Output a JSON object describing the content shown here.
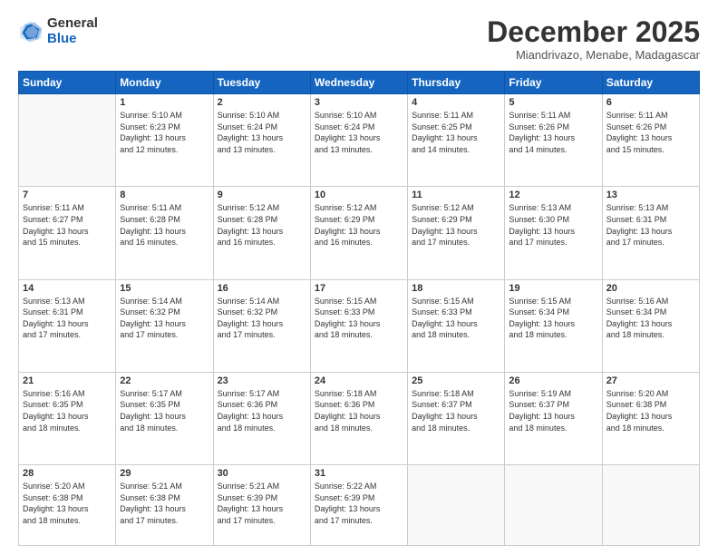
{
  "logo": {
    "general": "General",
    "blue": "Blue"
  },
  "title": "December 2025",
  "subtitle": "Miandrivazo, Menabe, Madagascar",
  "days_header": [
    "Sunday",
    "Monday",
    "Tuesday",
    "Wednesday",
    "Thursday",
    "Friday",
    "Saturday"
  ],
  "weeks": [
    [
      {
        "day": "",
        "info": ""
      },
      {
        "day": "1",
        "info": "Sunrise: 5:10 AM\nSunset: 6:23 PM\nDaylight: 13 hours\nand 12 minutes."
      },
      {
        "day": "2",
        "info": "Sunrise: 5:10 AM\nSunset: 6:24 PM\nDaylight: 13 hours\nand 13 minutes."
      },
      {
        "day": "3",
        "info": "Sunrise: 5:10 AM\nSunset: 6:24 PM\nDaylight: 13 hours\nand 13 minutes."
      },
      {
        "day": "4",
        "info": "Sunrise: 5:11 AM\nSunset: 6:25 PM\nDaylight: 13 hours\nand 14 minutes."
      },
      {
        "day": "5",
        "info": "Sunrise: 5:11 AM\nSunset: 6:26 PM\nDaylight: 13 hours\nand 14 minutes."
      },
      {
        "day": "6",
        "info": "Sunrise: 5:11 AM\nSunset: 6:26 PM\nDaylight: 13 hours\nand 15 minutes."
      }
    ],
    [
      {
        "day": "7",
        "info": "Sunrise: 5:11 AM\nSunset: 6:27 PM\nDaylight: 13 hours\nand 15 minutes."
      },
      {
        "day": "8",
        "info": "Sunrise: 5:11 AM\nSunset: 6:28 PM\nDaylight: 13 hours\nand 16 minutes."
      },
      {
        "day": "9",
        "info": "Sunrise: 5:12 AM\nSunset: 6:28 PM\nDaylight: 13 hours\nand 16 minutes."
      },
      {
        "day": "10",
        "info": "Sunrise: 5:12 AM\nSunset: 6:29 PM\nDaylight: 13 hours\nand 16 minutes."
      },
      {
        "day": "11",
        "info": "Sunrise: 5:12 AM\nSunset: 6:29 PM\nDaylight: 13 hours\nand 17 minutes."
      },
      {
        "day": "12",
        "info": "Sunrise: 5:13 AM\nSunset: 6:30 PM\nDaylight: 13 hours\nand 17 minutes."
      },
      {
        "day": "13",
        "info": "Sunrise: 5:13 AM\nSunset: 6:31 PM\nDaylight: 13 hours\nand 17 minutes."
      }
    ],
    [
      {
        "day": "14",
        "info": "Sunrise: 5:13 AM\nSunset: 6:31 PM\nDaylight: 13 hours\nand 17 minutes."
      },
      {
        "day": "15",
        "info": "Sunrise: 5:14 AM\nSunset: 6:32 PM\nDaylight: 13 hours\nand 17 minutes."
      },
      {
        "day": "16",
        "info": "Sunrise: 5:14 AM\nSunset: 6:32 PM\nDaylight: 13 hours\nand 17 minutes."
      },
      {
        "day": "17",
        "info": "Sunrise: 5:15 AM\nSunset: 6:33 PM\nDaylight: 13 hours\nand 18 minutes."
      },
      {
        "day": "18",
        "info": "Sunrise: 5:15 AM\nSunset: 6:33 PM\nDaylight: 13 hours\nand 18 minutes."
      },
      {
        "day": "19",
        "info": "Sunrise: 5:15 AM\nSunset: 6:34 PM\nDaylight: 13 hours\nand 18 minutes."
      },
      {
        "day": "20",
        "info": "Sunrise: 5:16 AM\nSunset: 6:34 PM\nDaylight: 13 hours\nand 18 minutes."
      }
    ],
    [
      {
        "day": "21",
        "info": "Sunrise: 5:16 AM\nSunset: 6:35 PM\nDaylight: 13 hours\nand 18 minutes."
      },
      {
        "day": "22",
        "info": "Sunrise: 5:17 AM\nSunset: 6:35 PM\nDaylight: 13 hours\nand 18 minutes."
      },
      {
        "day": "23",
        "info": "Sunrise: 5:17 AM\nSunset: 6:36 PM\nDaylight: 13 hours\nand 18 minutes."
      },
      {
        "day": "24",
        "info": "Sunrise: 5:18 AM\nSunset: 6:36 PM\nDaylight: 13 hours\nand 18 minutes."
      },
      {
        "day": "25",
        "info": "Sunrise: 5:18 AM\nSunset: 6:37 PM\nDaylight: 13 hours\nand 18 minutes."
      },
      {
        "day": "26",
        "info": "Sunrise: 5:19 AM\nSunset: 6:37 PM\nDaylight: 13 hours\nand 18 minutes."
      },
      {
        "day": "27",
        "info": "Sunrise: 5:20 AM\nSunset: 6:38 PM\nDaylight: 13 hours\nand 18 minutes."
      }
    ],
    [
      {
        "day": "28",
        "info": "Sunrise: 5:20 AM\nSunset: 6:38 PM\nDaylight: 13 hours\nand 18 minutes."
      },
      {
        "day": "29",
        "info": "Sunrise: 5:21 AM\nSunset: 6:38 PM\nDaylight: 13 hours\nand 17 minutes."
      },
      {
        "day": "30",
        "info": "Sunrise: 5:21 AM\nSunset: 6:39 PM\nDaylight: 13 hours\nand 17 minutes."
      },
      {
        "day": "31",
        "info": "Sunrise: 5:22 AM\nSunset: 6:39 PM\nDaylight: 13 hours\nand 17 minutes."
      },
      {
        "day": "",
        "info": ""
      },
      {
        "day": "",
        "info": ""
      },
      {
        "day": "",
        "info": ""
      }
    ]
  ]
}
